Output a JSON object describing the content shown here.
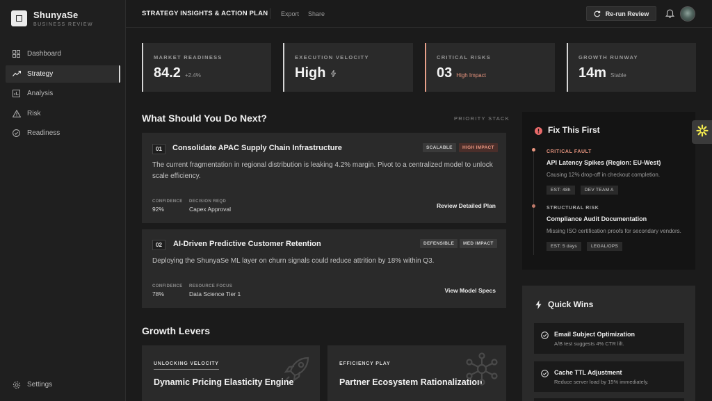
{
  "brand": {
    "name": "ShunyaSe",
    "subtitle": "BUSINESS REVIEW"
  },
  "sidebar": {
    "items": [
      {
        "label": "Dashboard",
        "icon": "grid-icon",
        "active": false
      },
      {
        "label": "Strategy",
        "icon": "trend-line-icon",
        "active": true
      },
      {
        "label": "Analysis",
        "icon": "bar-chart-icon",
        "active": false
      },
      {
        "label": "Risk",
        "icon": "warning-triangle-icon",
        "active": false
      },
      {
        "label": "Readiness",
        "icon": "check-circle-icon",
        "active": false
      }
    ],
    "settings_label": "Settings"
  },
  "header": {
    "title": "STRATEGY INSIGHTS & ACTION PLAN",
    "export_label": "Export",
    "share_label": "Share",
    "rerun_label": "Re-run Review"
  },
  "metrics": [
    {
      "label": "MARKET READINESS",
      "value": "84.2",
      "sub": "+2.4%"
    },
    {
      "label": "EXECUTION VELOCITY",
      "value": "High",
      "sub": ""
    },
    {
      "label": "CRITICAL RISKS",
      "value": "03",
      "sub": "High Impact"
    },
    {
      "label": "GROWTH RUNWAY",
      "value": "14m",
      "sub": "Stable"
    }
  ],
  "next": {
    "title": "What Should You Do Next?",
    "stack_label": "PRIORITY STACK",
    "cards": [
      {
        "num": "01",
        "title": "Consolidate APAC Supply Chain Infrastructure",
        "tags": [
          "SCALABLE",
          "HIGH IMPACT"
        ],
        "desc": "The current fragmentation in regional distribution is leaking 4.2% margin. Pivot to a centralized model to unlock scale efficiency.",
        "meta1_label": "CONFIDENCE",
        "meta1_value": "92%",
        "meta2_label": "DECISION REQD",
        "meta2_value": "Capex Approval",
        "link": "Review Detailed Plan"
      },
      {
        "num": "02",
        "title": "AI-Driven Predictive Customer Retention",
        "tags": [
          "DEFENSIBLE",
          "MED IMPACT"
        ],
        "desc": "Deploying the ShunyaSe ML layer on churn signals could reduce attrition by 18% within Q3.",
        "meta1_label": "CONFIDENCE",
        "meta1_value": "78%",
        "meta2_label": "RESOURCE FOCUS",
        "meta2_value": "Data Science Tier 1",
        "link": "View Model Specs"
      }
    ]
  },
  "levers": {
    "title": "Growth Levers",
    "cards": [
      {
        "label": "UNLOCKING VELOCITY",
        "title": "Dynamic Pricing Elasticity Engine",
        "icon": "rocket-icon"
      },
      {
        "label": "EFFICIENCY PLAY",
        "title": "Partner Ecosystem Rationalization",
        "icon": "network-icon"
      }
    ]
  },
  "fix": {
    "title": "Fix This First",
    "items": [
      {
        "kicker": "CRITICAL FAULT",
        "title": "API Latency Spikes (Region: EU-West)",
        "desc": "Causing 12% drop-off in checkout completion.",
        "chips": [
          "EST: 48h",
          "DEV TEAM A"
        ]
      },
      {
        "kicker": "STRUCTURAL RISK",
        "title": "Compliance Audit Documentation",
        "desc": "Missing ISO certification proofs for secondary vendors.",
        "chips": [
          "EST: 5 days",
          "LEGAL/OPS"
        ]
      }
    ]
  },
  "quick": {
    "title": "Quick Wins",
    "items": [
      {
        "title": "Email Subject Optimization",
        "desc": "A/B test suggests 4% CTR lift."
      },
      {
        "title": "Cache TTL Adjustment",
        "desc": "Reduce server load by 15% immediately."
      }
    ]
  },
  "colors": {
    "accent_risk": "#e8957f",
    "widget_yellow": "#f2e94e",
    "alert_red": "#e86a6a"
  }
}
